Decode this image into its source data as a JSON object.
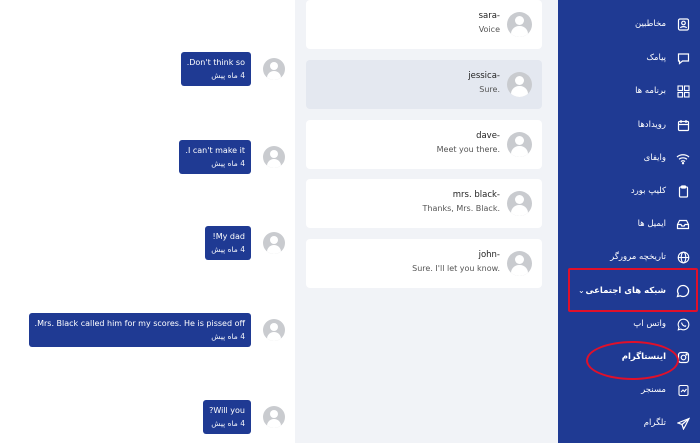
{
  "chat": {
    "messages": [
      {
        "text": "Don't think so.",
        "time": "4 ماه پیش"
      },
      {
        "text": "I can't make it.",
        "time": "4 ماه پیش"
      },
      {
        "text": "My dad!",
        "time": "4 ماه پیش"
      },
      {
        "text": "Mrs. Black called him for my scores. He is pissed off.",
        "time": "4 ماه پیش"
      },
      {
        "text": "Will you?",
        "time": "4 ماه پیش"
      }
    ]
  },
  "contacts": [
    {
      "name": "sara-",
      "preview": "Voice"
    },
    {
      "name": "jessica-",
      "preview": "Sure."
    },
    {
      "name": "dave-",
      "preview": "Meet you there."
    },
    {
      "name": "mrs. black-",
      "preview": "Thanks, Mrs. Black."
    },
    {
      "name": "john-",
      "preview": "Sure. I'll let you know."
    }
  ],
  "sidebar": {
    "items": [
      {
        "label": "مخاطبین",
        "icon": "contacts-icon"
      },
      {
        "label": "پیامک",
        "icon": "sms-icon"
      },
      {
        "label": "برنامه ها",
        "icon": "apps-icon"
      },
      {
        "label": "رویدادها",
        "icon": "calendar-icon"
      },
      {
        "label": "وایفای",
        "icon": "wifi-icon"
      },
      {
        "label": "کلیپ بورد",
        "icon": "clipboard-icon"
      },
      {
        "label": "ایمیل ها",
        "icon": "email-icon"
      },
      {
        "label": "تاریخچه مرورگر",
        "icon": "globe-icon"
      },
      {
        "label": "شبکه های اجتماعی",
        "icon": "chat-bubble-icon"
      },
      {
        "label": "واتس اپ",
        "icon": "whatsapp-icon"
      },
      {
        "label": "اینستاگرام",
        "icon": "instagram-icon"
      },
      {
        "label": "مسنجر",
        "icon": "messenger-icon"
      },
      {
        "label": "تلگرام",
        "icon": "telegram-icon"
      }
    ]
  },
  "colors": {
    "sidebar": "#1f3a93",
    "bubble": "#1f3a93",
    "highlight": "#e0102a"
  }
}
